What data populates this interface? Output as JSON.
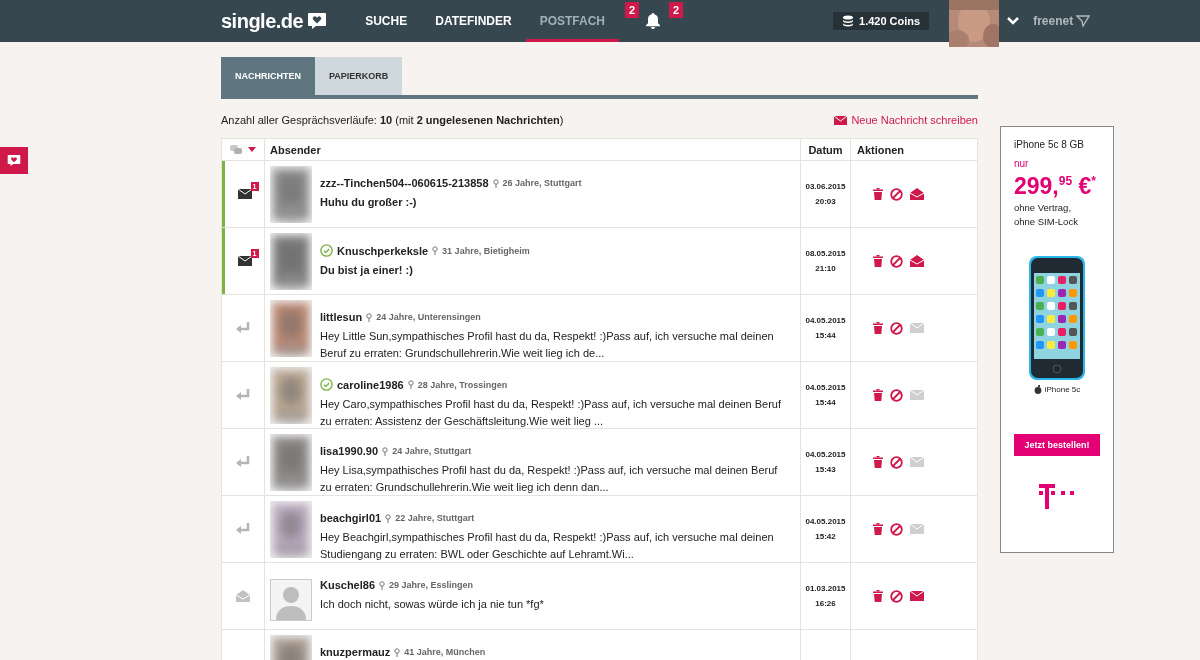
{
  "header": {
    "logo": "single.de",
    "nav": [
      {
        "label": "SUCHE",
        "selected": false
      },
      {
        "label": "DATEFINDER",
        "selected": false
      },
      {
        "label": "POSTFACH",
        "selected": true,
        "badge": "2"
      }
    ],
    "notifications_badge": "2",
    "coins": "1.420 Coins",
    "partner": "freenet"
  },
  "tabs": [
    {
      "label": "NACHRICHTEN",
      "selected": true
    },
    {
      "label": "PAPIERKORB",
      "selected": false
    }
  ],
  "summary": "Anzahl aller Gesprächsverläufe: **10** (mit **2 ungelesenen Nachrichten**)",
  "new_message_link": "Neue Nachricht schreiben",
  "table": {
    "columns": [
      "Absender",
      "Datum",
      "Aktionen"
    ],
    "rows": [
      {
        "kind": "unread",
        "unread_count": "1",
        "has_photo": true,
        "verified": false,
        "name": "zzz--Tinchen504--060615-213858",
        "info": "26 Jahre, Stuttgart",
        "message": "Huhu du großer :-)",
        "date": "03.06.2015",
        "time": "20:03"
      },
      {
        "kind": "unread",
        "unread_count": "1",
        "has_photo": true,
        "verified": true,
        "name": "Knuschperkeksle",
        "info": "31 Jahre, Bietigheim",
        "message": "Du bist ja einer! :)",
        "date": "08.05.2015",
        "time": "21:10"
      },
      {
        "kind": "replied",
        "has_photo": true,
        "verified": false,
        "name": "littlesun",
        "info": "24 Jahre, Unterensingen",
        "message": "Hey Little Sun,sympathisches Profil hast du da, Respekt! :)Pass auf, ich versuche mal deinen Beruf zu erraten: Grundschullehrerin.Wie weit lieg ich de...",
        "date": "04.05.2015",
        "time": "15:44"
      },
      {
        "kind": "replied",
        "has_photo": true,
        "verified": true,
        "name": "caroline1986",
        "info": "28 Jahre, Trossingen",
        "message": "Hey Caro,sympathisches Profil hast du da, Respekt! :)Pass auf, ich versuche mal deinen Beruf zu erraten: Assistenz der Geschäftsleitung.Wie weit lieg ...",
        "date": "04.05.2015",
        "time": "15:44"
      },
      {
        "kind": "replied",
        "has_photo": true,
        "verified": false,
        "name": "lisa1990.90",
        "info": "24 Jahre, Stuttgart",
        "message": "Hey Lisa,sympathisches Profil hast du da, Respekt! :)Pass auf, ich versuche mal deinen Beruf zu erraten: Grundschullehrerin.Wie weit lieg ich denn dan...",
        "date": "04.05.2015",
        "time": "15:43"
      },
      {
        "kind": "replied",
        "has_photo": true,
        "verified": false,
        "name": "beachgirl01",
        "info": "22 Jahre, Stuttgart",
        "message": "Hey Beachgirl,sympathisches Profil hast du da, Respekt! :)Pass auf, ich versuche mal deinen Studiengang zu erraten: BWL oder Geschichte auf Lehramt.Wi...",
        "date": "04.05.2015",
        "time": "15:42"
      },
      {
        "kind": "read",
        "has_photo": false,
        "verified": false,
        "name": "Kuschel86",
        "info": "29 Jahre, Esslingen",
        "message": "Ich doch nicht, sowas würde ich ja nie tun *fg*",
        "date": "01.03.2015",
        "time": "16:26"
      },
      {
        "kind": "cut",
        "has_photo": true,
        "verified": false,
        "name": "knuzpermauz",
        "info": "41 Jahre, München"
      }
    ]
  },
  "ad": {
    "title": "iPhone 5c 8 GB",
    "price_prefix": "nur",
    "price": "299,$^{95}$ €$^{*}$",
    "terms": [
      "ohne Vertrag,",
      "ohne SIM-Lock"
    ],
    "product_logo": "iPhone 5c",
    "button": "Jetzt bestellen!"
  }
}
